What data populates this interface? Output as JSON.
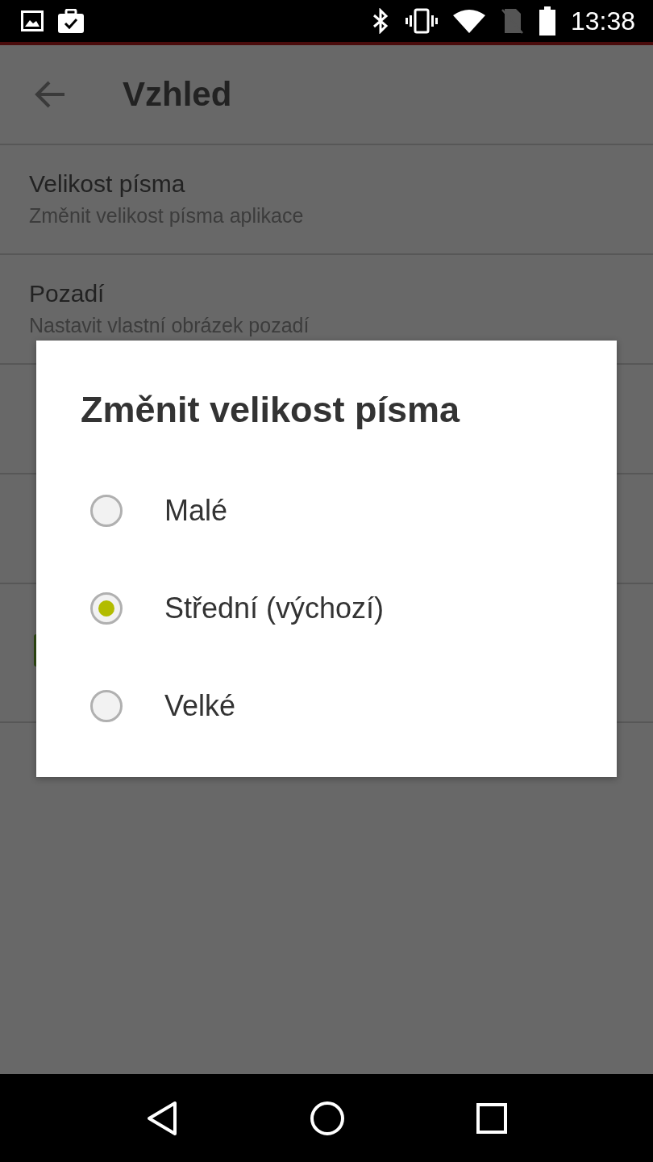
{
  "status_bar": {
    "time": "13:38"
  },
  "app_bar": {
    "title": "Vzhled"
  },
  "settings": [
    {
      "title": "Velikost písma",
      "subtitle": "Změnit velikost písma aplikace"
    },
    {
      "title": "Pozadí",
      "subtitle": "Nastavit vlastní obrázek pozadí"
    },
    {
      "kind": "covered"
    },
    {
      "kind": "covered"
    },
    {
      "kind": "swatch"
    }
  ],
  "dialog": {
    "title": "Změnit velikost písma",
    "options": [
      {
        "label": "Malé",
        "selected": false
      },
      {
        "label": "Střední (výchozí)",
        "selected": true
      },
      {
        "label": "Velké",
        "selected": false
      }
    ]
  }
}
